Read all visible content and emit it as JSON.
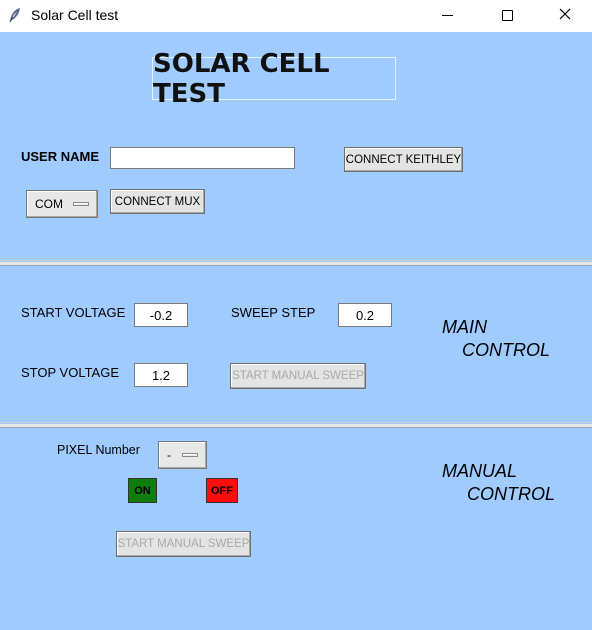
{
  "window": {
    "title": "Solar Cell test",
    "controls": {
      "minimize": "—",
      "maximize": "☐",
      "close": "✕"
    }
  },
  "header": {
    "heading": "SOLAR CELL TEST",
    "user_name_label": "USER NAME",
    "user_name_value": "",
    "connect_keithley": "CONNECT KEITHLEY",
    "com_select": "COM",
    "connect_mux": "CONNECT MUX"
  },
  "main": {
    "start_voltage_label": "START VOLTAGE",
    "start_voltage_value": "-0.2",
    "sweep_step_label": "SWEEP STEP",
    "sweep_step_value": "0.2",
    "stop_voltage_label": "STOP VOLTAGE",
    "stop_voltage_value": "1.2",
    "start_manual_sweep": "START MANUAL SWEEP",
    "title_line1": "MAIN",
    "title_line2": "CONTROL"
  },
  "manual": {
    "pixel_label": "PIXEL Number",
    "pixel_select": "-",
    "on_label": "ON",
    "off_label": "OFF",
    "start_manual_sweep": "START MANUAL SWEEP",
    "title_line1": "MANUAL",
    "title_line2": "CONTROL"
  },
  "colors": {
    "background": "#a0cbff",
    "on": "#0d7d0d",
    "off": "#ff0d0d"
  }
}
